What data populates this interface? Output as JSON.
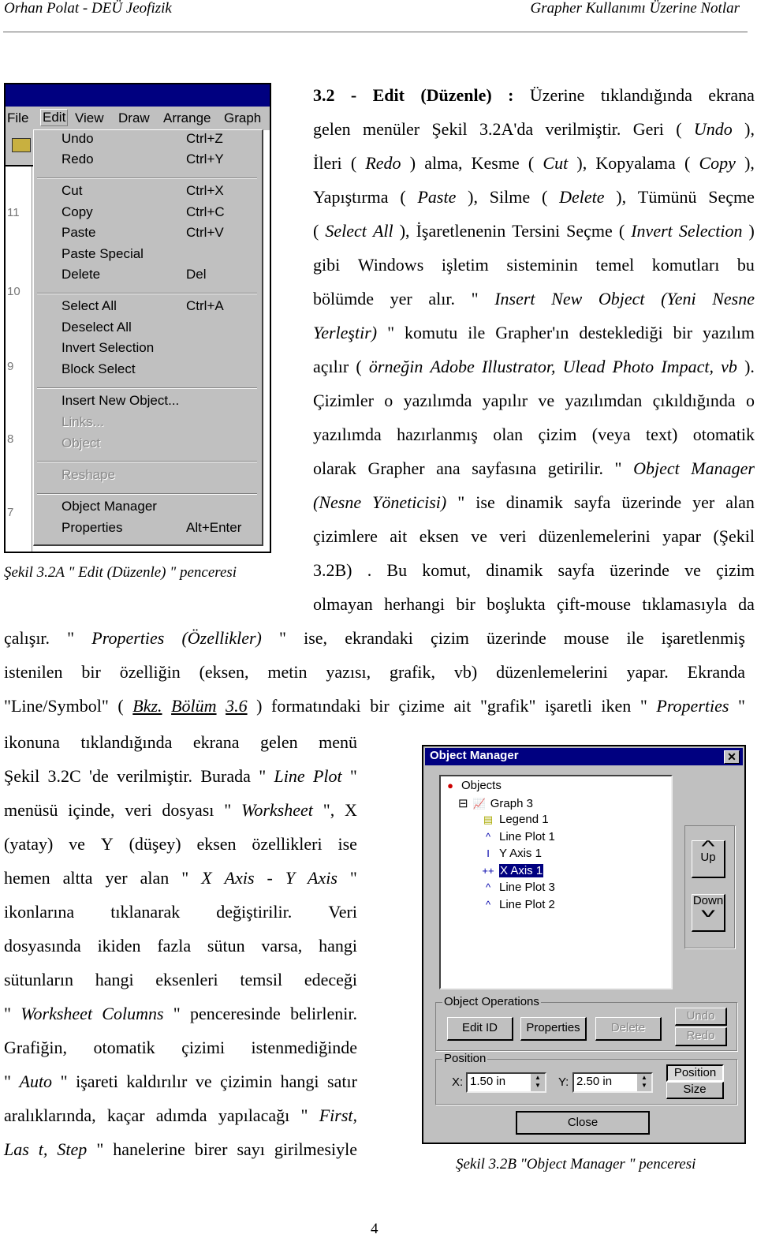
{
  "header": {
    "left": "Orhan Polat - DEÜ Jeofizik",
    "right": "Grapher Kullanımı Üzerine Notlar"
  },
  "menu_shot": {
    "menubar": [
      "File",
      "Edit",
      "View",
      "Draw",
      "Arrange",
      "Graph"
    ],
    "ruler": [
      "11",
      "10",
      "9",
      "8",
      "7"
    ],
    "items": [
      {
        "label": "Undo",
        "shortcut": "Ctrl+Z",
        "disabled": false
      },
      {
        "label": "Redo",
        "shortcut": "Ctrl+Y",
        "disabled": false
      },
      {
        "label": "Cut",
        "shortcut": "Ctrl+X",
        "disabled": false
      },
      {
        "label": "Copy",
        "shortcut": "Ctrl+C",
        "disabled": false
      },
      {
        "label": "Paste",
        "shortcut": "Ctrl+V",
        "disabled": false
      },
      {
        "label": "Paste Special",
        "shortcut": "",
        "disabled": false
      },
      {
        "label": "Delete",
        "shortcut": "Del",
        "disabled": false
      },
      {
        "label": "Select All",
        "shortcut": "Ctrl+A",
        "disabled": false
      },
      {
        "label": "Deselect All",
        "shortcut": "",
        "disabled": false
      },
      {
        "label": "Invert Selection",
        "shortcut": "",
        "disabled": false
      },
      {
        "label": "Block Select",
        "shortcut": "",
        "disabled": false
      },
      {
        "label": "Insert New Object...",
        "shortcut": "",
        "disabled": false
      },
      {
        "label": "Links...",
        "shortcut": "",
        "disabled": true
      },
      {
        "label": "Object",
        "shortcut": "",
        "disabled": true
      },
      {
        "label": "Reshape",
        "shortcut": "",
        "disabled": true
      },
      {
        "label": "Object Manager",
        "shortcut": "",
        "disabled": false
      },
      {
        "label": "Properties",
        "shortcut": "Alt+Enter",
        "disabled": false
      }
    ],
    "caption": "Şekil 3.2A \" Edit (Düzenle) \" penceresi"
  },
  "object_manager": {
    "title": "Object Manager",
    "close": "✕",
    "tree": [
      {
        "label": "Objects",
        "icon": "objects-icon"
      },
      {
        "label": "Graph 3",
        "icon": "graph-icon"
      },
      {
        "label": "Legend 1",
        "icon": "legend-icon"
      },
      {
        "label": "Line Plot 1",
        "icon": "line-plot-icon"
      },
      {
        "label": "Y Axis 1",
        "icon": "y-axis-icon"
      },
      {
        "label": "X Axis 1",
        "icon": "x-axis-icon",
        "selected": true
      },
      {
        "label": "Line Plot 3",
        "icon": "line-plot-icon"
      },
      {
        "label": "Line Plot 2",
        "icon": "line-plot-icon"
      }
    ],
    "up": "Up",
    "down": "Down",
    "ops_label": "Object Operations",
    "edit_id": "Edit ID",
    "properties": "Properties",
    "delete": "Delete",
    "undo": "Undo",
    "redo": "Redo",
    "pos_label": "Position",
    "x_label": "X:",
    "x_value": "1.50 in",
    "y_label": "Y:",
    "y_value": "2.50 in",
    "position_btn": "Position",
    "size_btn": "Size",
    "close_btn": "Close",
    "caption": "Şekil 3.2B \"Object Manager \" penceresi",
    "accent": "#000080"
  },
  "text_right": [
    [
      [
        "3.2 - Edit (Düzenle) :",
        "b"
      ],
      [
        " Üzerine tıklandığında ekrana",
        ""
      ]
    ],
    [
      [
        "gelen menüler Şekil 3.2A'da verilmiştir. Geri (",
        ""
      ],
      [
        "Undo",
        "i"
      ],
      [
        "),",
        ""
      ]
    ],
    [
      [
        "İleri (",
        ""
      ],
      [
        "Redo",
        "i"
      ],
      [
        ") alma, Kesme (",
        ""
      ],
      [
        "Cut",
        "i"
      ],
      [
        "), Kopyalama (",
        ""
      ],
      [
        "Copy",
        "i"
      ],
      [
        "),",
        ""
      ]
    ],
    [
      [
        "Yapıştırma (",
        ""
      ],
      [
        "Paste",
        "i"
      ],
      [
        "), Silme (",
        ""
      ],
      [
        "Delete",
        "i"
      ],
      [
        "), Tümünü Seçme",
        ""
      ]
    ],
    [
      [
        "(",
        ""
      ],
      [
        "Select All",
        "i"
      ],
      [
        "), İşaretlenenin Tersini Seçme (",
        ""
      ],
      [
        "Invert Selection",
        "i"
      ],
      [
        ")",
        ""
      ]
    ],
    [
      [
        "gibi Windows işletim sisteminin temel komutları bu",
        ""
      ]
    ],
    [
      [
        "bölümde yer alır. \"",
        ""
      ],
      [
        "Insert New Object (Yeni Nesne",
        "i"
      ]
    ],
    [
      [
        "Yerleştir)",
        "i"
      ],
      [
        "\" komutu ile Grapher'ın desteklediği bir yazılım",
        ""
      ]
    ],
    [
      [
        "açılır (",
        ""
      ],
      [
        "örneğin Adobe Illustrator, Ulead Photo Impact, vb",
        "i"
      ],
      [
        ").",
        ""
      ]
    ],
    [
      [
        "Çizimler o yazılımda yapılır ve yazılımdan çıkıldığında o",
        ""
      ]
    ],
    [
      [
        "yazılımda hazırlanmış olan çizim (veya text) otomatik",
        ""
      ]
    ],
    [
      [
        "olarak Grapher ana sayfasına getirilir. \"",
        ""
      ],
      [
        "Object Manager",
        "i"
      ]
    ],
    [
      [
        "(Nesne Yöneticisi)",
        "i"
      ],
      [
        "\" ise dinamik sayfa üzerinde yer alan",
        ""
      ]
    ],
    [
      [
        "çizimlere ait eksen ve veri düzenlemelerini yapar (Şekil",
        ""
      ]
    ],
    [
      [
        "3.2B) . Bu komut, dinamik sayfa üzerinde ve çizim",
        ""
      ]
    ],
    [
      [
        "olmayan herhangi bir boşlukta çift-mouse tıklamasıyla da",
        ""
      ]
    ]
  ],
  "text_full": [
    [
      [
        "çalışır. \"",
        ""
      ],
      [
        "Properties (Özellikler)",
        "i"
      ],
      [
        "\" ise, ekrandaki çizim üzerinde mouse ile işaretlenmiş",
        ""
      ]
    ],
    [
      [
        "istenilen bir özelliğin (eksen, metin yazısı, grafik, vb) düzenlemelerini yapar. Ekranda",
        ""
      ]
    ],
    [
      [
        "\"Line/Symbol\" (",
        ""
      ],
      [
        "Bkz. Bölüm 3.6",
        "iu"
      ],
      [
        ") formatındaki bir çizime ait \"grafik\" işaretli iken \"",
        ""
      ],
      [
        "Properties",
        "i"
      ],
      [
        "\"",
        ""
      ]
    ]
  ],
  "text_left": [
    [
      [
        "ikonuna tıklandığında ekrana gelen menü",
        ""
      ]
    ],
    [
      [
        "Şekil 3.2C 'de verilmiştir. Burada \"",
        ""
      ],
      [
        "Line Plot",
        "i"
      ],
      [
        "\"",
        ""
      ]
    ],
    [
      [
        "menüsü içinde, veri dosyası \"",
        ""
      ],
      [
        "Worksheet",
        "i"
      ],
      [
        "\", X",
        ""
      ]
    ],
    [
      [
        "(yatay) ve Y (düşey) eksen özellikleri ise",
        ""
      ]
    ],
    [
      [
        "hemen altta yer alan \"",
        ""
      ],
      [
        "X Axis - Y Axis",
        "i"
      ],
      [
        "\"",
        ""
      ]
    ],
    [
      [
        "ikonlarına tıklanarak değiştirilir. Veri",
        ""
      ]
    ],
    [
      [
        "dosyasında ikiden fazla sütun varsa, hangi",
        ""
      ]
    ],
    [
      [
        "sütunların hangi eksenleri temsil edeceği",
        ""
      ]
    ],
    [
      [
        "\"",
        ""
      ],
      [
        "Worksheet Columns",
        "i"
      ],
      [
        "\" penceresinde belirlenir.",
        ""
      ]
    ],
    [
      [
        "Grafiğin, otomatik çizimi istenmediğinde",
        ""
      ]
    ],
    [
      [
        "\"",
        ""
      ],
      [
        "Auto",
        "i"
      ],
      [
        "\" işareti kaldırılır ve çizimin hangi satır",
        ""
      ]
    ],
    [
      [
        "aralıklarında, kaçar adımda yapılacağı \"",
        ""
      ],
      [
        "First,",
        "i"
      ]
    ],
    [
      [
        "Las t, Step",
        "i"
      ],
      [
        "\" hanelerine birer sayı girilmesiyle",
        ""
      ]
    ]
  ],
  "page_number": "4"
}
